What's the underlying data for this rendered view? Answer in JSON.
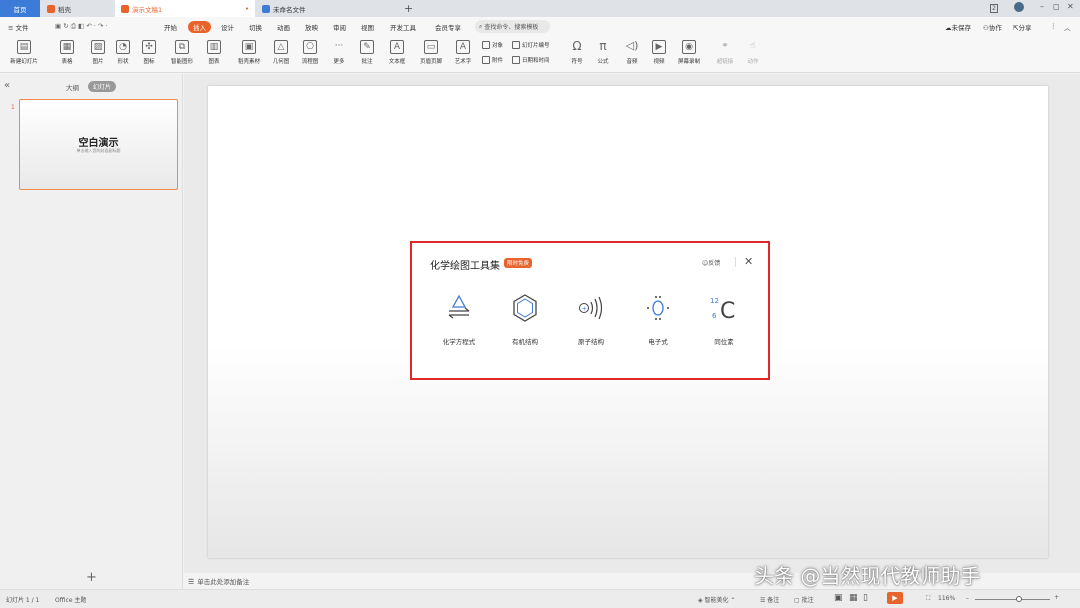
{
  "titlebar": {
    "tabs": [
      {
        "label": "首页"
      },
      {
        "label": "稻壳"
      },
      {
        "label": "演示文稿1"
      },
      {
        "label": "未命名文件"
      }
    ],
    "add_tab": "+"
  },
  "menubar": {
    "file": "≡ 文件",
    "items": [
      "开始",
      "插入",
      "设计",
      "切换",
      "动画",
      "放映",
      "审阅",
      "视图",
      "开发工具",
      "会员专享"
    ],
    "search_placeholder": "查找命令、搜索模板",
    "right": {
      "unsaved": "未保存",
      "collab": "协作",
      "share": "分享"
    }
  },
  "ribbon": {
    "big": [
      {
        "label": "新建幻灯片",
        "icon": "new-slide-icon"
      },
      {
        "label": "表格",
        "icon": "table-icon"
      },
      {
        "label": "图片",
        "icon": "picture-icon"
      },
      {
        "label": "形状",
        "icon": "shape-icon"
      },
      {
        "label": "图标",
        "icon": "icons-icon"
      },
      {
        "label": "智能图形",
        "icon": "smartart-icon"
      },
      {
        "label": "图表",
        "icon": "chart-icon"
      },
      {
        "label": "稻壳素材",
        "icon": "material-icon"
      },
      {
        "label": "几何图",
        "icon": "geometry-icon"
      },
      {
        "label": "流程图",
        "icon": "flowchart-icon"
      },
      {
        "label": "更多",
        "icon": "more-icon"
      },
      {
        "label": "批注",
        "icon": "comment-icon"
      },
      {
        "label": "文本框",
        "icon": "textbox-icon"
      },
      {
        "label": "页眉页脚",
        "icon": "header-footer-icon"
      },
      {
        "label": "艺术字",
        "icon": "wordart-icon"
      },
      {
        "label": "符号",
        "icon": "symbol-icon"
      },
      {
        "label": "公式",
        "icon": "formula-icon"
      },
      {
        "label": "音频",
        "icon": "audio-icon"
      },
      {
        "label": "视频",
        "icon": "video-icon"
      },
      {
        "label": "屏幕录制",
        "icon": "screen-record-icon"
      },
      {
        "label": "超链接",
        "icon": "hyperlink-icon"
      },
      {
        "label": "动作",
        "icon": "action-icon"
      }
    ],
    "small": {
      "object": "对象",
      "slide_number": "幻灯片编号",
      "attachment": "附件",
      "datetime": "日期和时间"
    }
  },
  "sidebar": {
    "outline": "大纲",
    "slides": "幻灯片",
    "thumb_number": "1",
    "thumb_title": "空白演示",
    "thumb_subtitle": "单击输入您的封面副标题"
  },
  "notes": "单击此处添加备注",
  "dialog": {
    "title": "化学绘图工具集",
    "badge": "限时免费",
    "feedback": "反馈",
    "tools": [
      {
        "label": "化学方程式",
        "icon": "chemical-equation-icon"
      },
      {
        "label": "有机结构",
        "icon": "organic-structure-icon"
      },
      {
        "label": "原子结构",
        "icon": "atomic-structure-icon"
      },
      {
        "label": "电子式",
        "icon": "electron-formula-icon"
      },
      {
        "label": "同位素",
        "icon": "isotope-icon"
      }
    ],
    "isotope_mass": "12",
    "isotope_number": "6",
    "isotope_symbol": "C"
  },
  "status": {
    "slide_info": "幻灯片 1 / 1",
    "theme": "Office 主题",
    "smart_beautify": "智能美化",
    "notes": "备注",
    "comments": "批注",
    "zoom": "116%"
  },
  "watermark": "头条 @当然现代教师助手",
  "colors": {
    "accent": "#e8642c",
    "dialog_border": "#e0282a",
    "home_tab": "#3d7bd9"
  }
}
